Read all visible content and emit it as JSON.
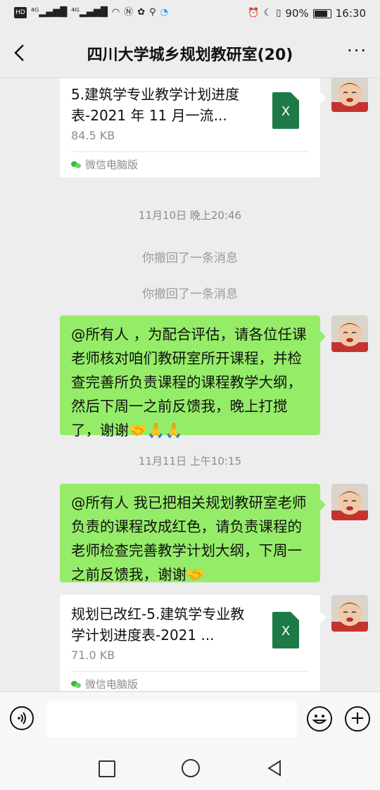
{
  "status_bar": {
    "left_icons": [
      "hd-icon",
      "4g-signal-icon",
      "4g-signal-icon",
      "wifi-icon",
      "nfc-icon",
      "app-icon",
      "key-icon",
      "app-ring-icon"
    ],
    "hd_label": "HD",
    "sig1_label": "⁴ᴳ",
    "sig2_label": "⁴ᴳ",
    "battery": "90%",
    "time": "16:30"
  },
  "header": {
    "title": "四川大学城乡规划教研室(20)",
    "more": "···"
  },
  "messages": {
    "file1": {
      "name": "5.建筑学专业教学计划进度表-2021 年 11 月一流...",
      "size": "84.5 KB",
      "source": "微信电脑版",
      "icon_label": "X"
    },
    "time1": "11月10日 晚上20:46",
    "recall1": "你撤回了一条消息",
    "recall2": "你撤回了一条消息",
    "text1": "@所有人 ，为配合评估，请各位任课老师核对咱们教研室所开课程，并检查完善所负责课程的课程教学大纲，然后下周一之前反馈我，晚上打搅了，谢谢🤝🙏🙏",
    "time2": "11月11日 上午10:15",
    "text2": "@所有人  我已把相关规划教研室老师负责的课程改成红色，请负责课程的老师检查完善教学计划大纲，下周一之前反馈我，谢谢🤝",
    "file2": {
      "name": "规划已改红-5.建筑学专业教学计划进度表-2021 ...",
      "size": "71.0 KB",
      "source": "微信电脑版",
      "icon_label": "X"
    }
  },
  "input": {
    "placeholder": ""
  },
  "colors": {
    "own_bubble": "#95ec69",
    "background": "#ededed",
    "excel_green": "#1d7a45"
  }
}
